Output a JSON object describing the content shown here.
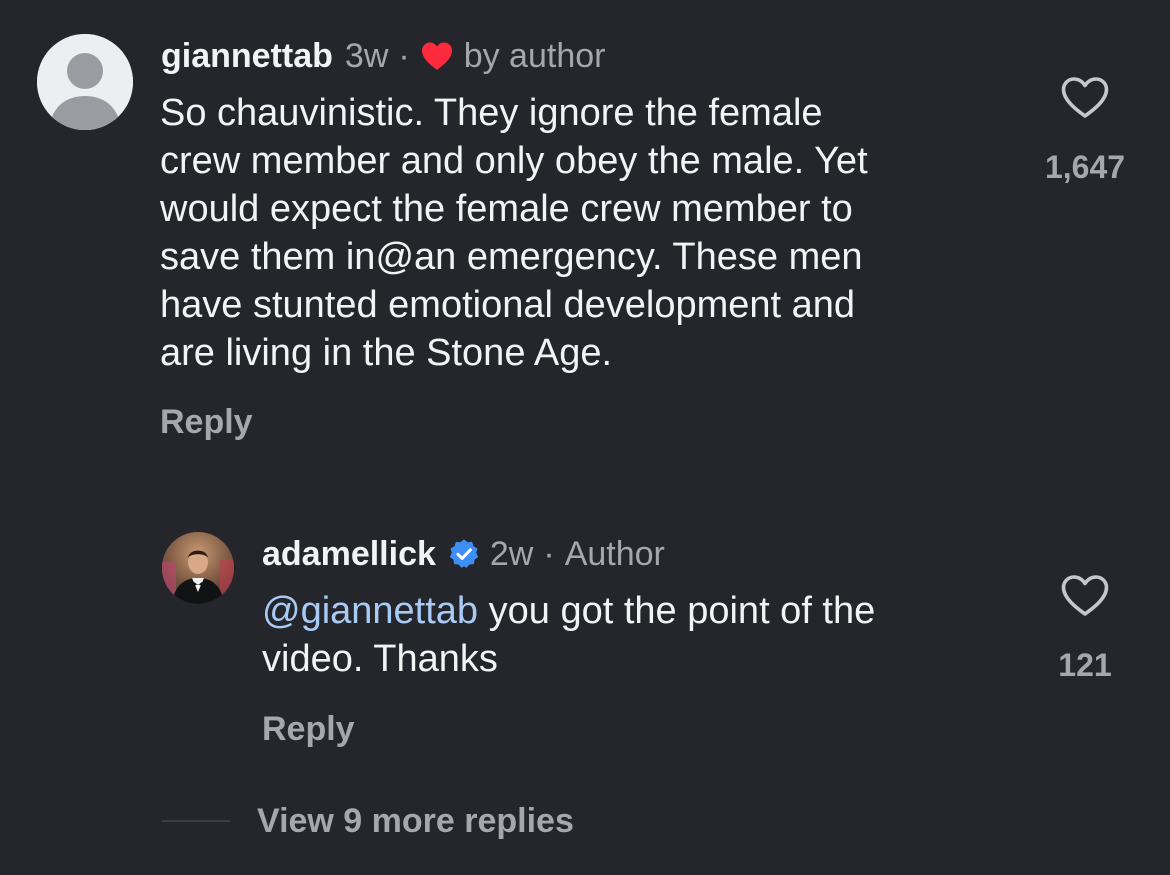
{
  "comment": {
    "username": "giannettab",
    "time": "3w",
    "separator": "·",
    "liked_label": "by author",
    "avatar_icon": "default-avatar-icon",
    "text_lines": [
      "So chauvinistic. They ignore the female",
      "crew member and only obey the male. Yet",
      "would expect the female crew member to",
      "save them in@an emergency. These men",
      "have stunted emotional development and",
      "are living in the Stone Age."
    ],
    "reply_label": "Reply",
    "like_icon": "heart-outline-icon",
    "like_count": "1,647"
  },
  "reply": {
    "username": "adamellick",
    "verified_icon": "verified-badge-icon",
    "time": "2w",
    "separator": "·",
    "role": "Author",
    "mention": "@giannettab",
    "text_rest": " you got the point of the",
    "text_line2": "video. Thanks",
    "reply_label": "Reply",
    "like_icon": "heart-outline-icon",
    "like_count": "121"
  },
  "view_more_label": "View 9 more replies",
  "colors": {
    "background": "#25262b",
    "text": "#f2f3f5",
    "muted": "#a4a7ad",
    "mention": "#a8cbf5",
    "liked_heart": "#ff2a3d",
    "verified": "#3d8ff6"
  }
}
